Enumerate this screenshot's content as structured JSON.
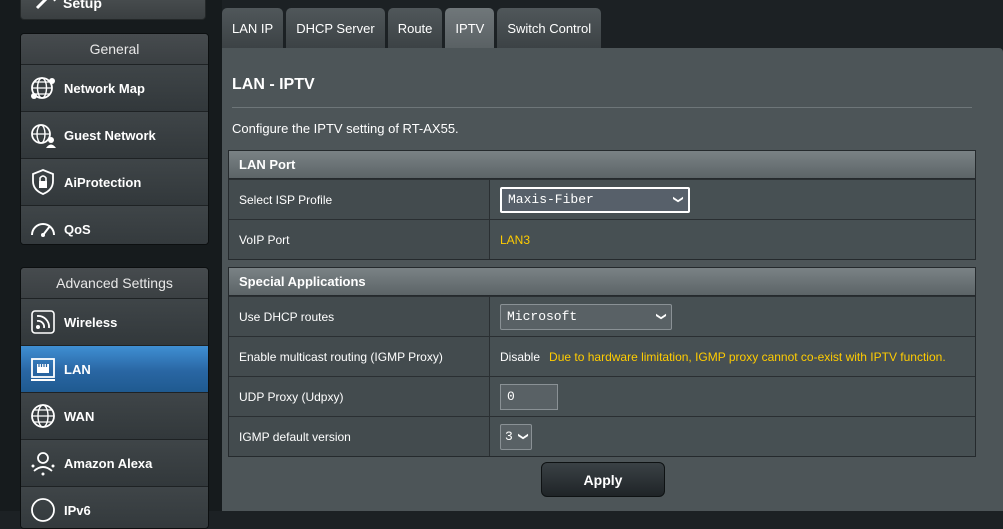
{
  "sidebar": {
    "top_item": {
      "label": "Setup",
      "icon": "wand-icon"
    },
    "general": {
      "header": "General",
      "items": [
        {
          "label": "Network Map",
          "icon": "globe-network-icon"
        },
        {
          "label": "Guest Network",
          "icon": "guest-globe-icon"
        },
        {
          "label": "AiProtection",
          "icon": "shield-lock-icon"
        },
        {
          "label": "QoS",
          "icon": "speedometer-icon"
        }
      ]
    },
    "advanced": {
      "header": "Advanced Settings",
      "items": [
        {
          "label": "Wireless",
          "icon": "wifi-icon"
        },
        {
          "label": "LAN",
          "icon": "lan-port-icon",
          "active": true
        },
        {
          "label": "WAN",
          "icon": "globe-icon"
        },
        {
          "label": "Amazon Alexa",
          "icon": "alexa-icon"
        },
        {
          "label": "IPv6",
          "icon": "ipv6-icon"
        }
      ]
    }
  },
  "tabs": [
    {
      "label": "LAN IP"
    },
    {
      "label": "DHCP Server"
    },
    {
      "label": "Route"
    },
    {
      "label": "IPTV",
      "active": true
    },
    {
      "label": "Switch Control"
    }
  ],
  "main": {
    "title": "LAN - IPTV",
    "description": "Configure the IPTV setting of RT-AX55.",
    "lan_port": {
      "header": "LAN Port",
      "isp_profile": {
        "label": "Select ISP Profile",
        "value": "Maxis-Fiber"
      },
      "voip_port": {
        "label": "VoIP Port",
        "value": "LAN3"
      }
    },
    "special": {
      "header": "Special Applications",
      "dhcp_routes": {
        "label": "Use DHCP routes",
        "value": "Microsoft"
      },
      "igmp_proxy": {
        "label": "Enable multicast routing (IGMP Proxy)",
        "value": "Disable",
        "warning": "Due to hardware limitation, IGMP proxy cannot co-exist with IPTV function."
      },
      "udp_proxy": {
        "label": "UDP Proxy (Udpxy)",
        "value": "0"
      },
      "igmp_version": {
        "label": "IGMP default version",
        "value": "3"
      }
    },
    "apply_label": "Apply"
  },
  "colors": {
    "accent_blue": "#2966a3",
    "warning_yellow": "#ffcc00",
    "panel_bg": "#4d5558"
  }
}
